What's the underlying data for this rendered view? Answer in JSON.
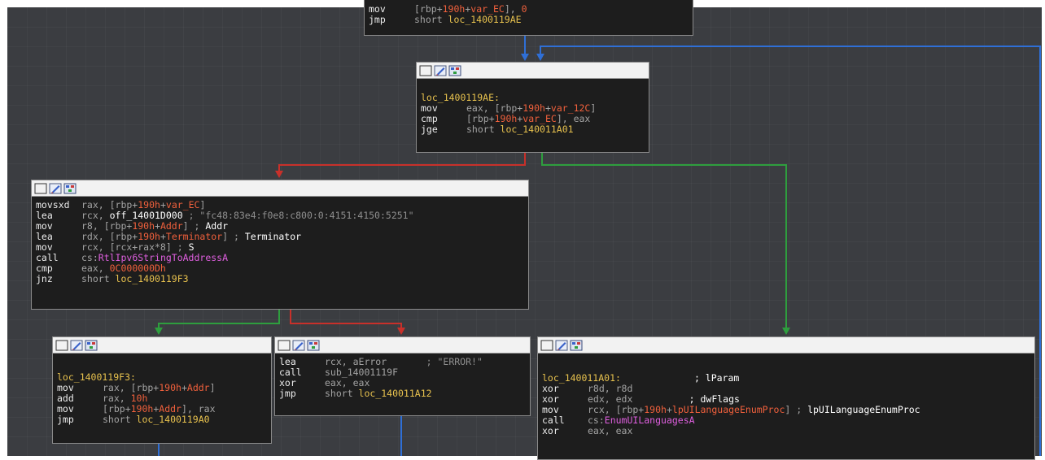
{
  "nodes": {
    "top": {
      "line1": {
        "mn": "mov",
        "a": "[rbp+",
        "b": "190h",
        "c": "+",
        "d": "var_EC",
        "e": "], ",
        "f": "0"
      },
      "line2": {
        "mn": "jmp",
        "a": "short ",
        "b": "loc_1400119AE"
      }
    },
    "loop": {
      "label": "loc_1400119AE:",
      "l1": {
        "mn": "mov",
        "a": "eax, [rbp+",
        "b": "190h",
        "c": "+",
        "d": "var_12C",
        "e": "]"
      },
      "l2": {
        "mn": "cmp",
        "a": "[rbp+",
        "b": "190h",
        "c": "+",
        "d": "var_EC",
        "e": "], eax"
      },
      "l3": {
        "mn": "jge",
        "a": "short ",
        "b": "loc_140011A01"
      }
    },
    "body": {
      "l1": {
        "mn": "movsxd",
        "a": "rax, [rbp+",
        "b": "190h",
        "c": "+",
        "d": "var_EC",
        "e": "]"
      },
      "l2": {
        "mn": "lea",
        "a": "rcx, ",
        "b": "off_14001D000",
        "c": " ; \"fc48:83e4:f0e8:c800:0:4151:4150:5251\""
      },
      "l3": {
        "mn": "mov",
        "a": "r8, [rbp+",
        "b": "190h",
        "c": "+",
        "d": "Addr",
        "e": "] ; ",
        "f": "Addr"
      },
      "l4": {
        "mn": "lea",
        "a": "rdx, [rbp+",
        "b": "190h",
        "c": "+",
        "d": "Terminator",
        "e": "] ; ",
        "f": "Terminator"
      },
      "l5": {
        "mn": "mov",
        "a": "rcx, [rcx+rax*8] ; ",
        "b": "S"
      },
      "l6": {
        "mn": "call",
        "a": "cs:",
        "b": "RtlIpv6StringToAddressA"
      },
      "l7": {
        "mn": "cmp",
        "a": "eax, ",
        "b": "0C000000Dh"
      },
      "l8": {
        "mn": "jnz",
        "a": "short ",
        "b": "loc_1400119F3"
      }
    },
    "inc": {
      "label": "loc_1400119F3:",
      "l1": {
        "mn": "mov",
        "a": "rax, [rbp+",
        "b": "190h",
        "c": "+",
        "d": "Addr",
        "e": "]"
      },
      "l2": {
        "mn": "add",
        "a": "rax, ",
        "b": "10h"
      },
      "l3": {
        "mn": "mov",
        "a": "[rbp+",
        "b": "190h",
        "c": "+",
        "d": "Addr",
        "e": "], rax"
      },
      "l4": {
        "mn": "jmp",
        "a": "short ",
        "b": "loc_1400119A0"
      }
    },
    "error": {
      "l1": {
        "mn": "lea",
        "a": "rcx, aError",
        "b": "       ; \"ERROR!\""
      },
      "l2": {
        "mn": "call",
        "a": "sub_14001119F"
      },
      "l3": {
        "mn": "xor",
        "a": "eax, eax"
      },
      "l4": {
        "mn": "jmp",
        "a": "short ",
        "b": "loc_140011A12"
      }
    },
    "exit": {
      "label": "loc_140011A01:",
      "label_cmt": "             ; lParam",
      "l1": {
        "mn": "xor",
        "a": "r8d, r8d"
      },
      "l2": {
        "mn": "xor",
        "a": "edx, edx",
        "b": "          ; dwFlags"
      },
      "l3": {
        "mn": "mov",
        "a": "rcx, [rbp+",
        "b": "190h",
        "c": "+",
        "d": "lpUILanguageEnumProc",
        "e": "] ; ",
        "f": "lpUILanguageEnumProc"
      },
      "l4": {
        "mn": "call",
        "a": "cs:",
        "b": "EnumUILanguagesA"
      },
      "l5": {
        "mn": "xor",
        "a": "eax, eax"
      }
    }
  },
  "icon_names": [
    "color-palette-icon",
    "edit-node-icon",
    "graph-overview-icon"
  ],
  "colors": {
    "canvas": "#3b3d41",
    "node_bg": "#1d1d1d",
    "edge_true": "#2e9e3e",
    "edge_false": "#c8302a",
    "edge_uncond": "#2f6fd6",
    "label": "#e8c24e",
    "offset": "#f0603c",
    "api": "#df5fdf"
  }
}
